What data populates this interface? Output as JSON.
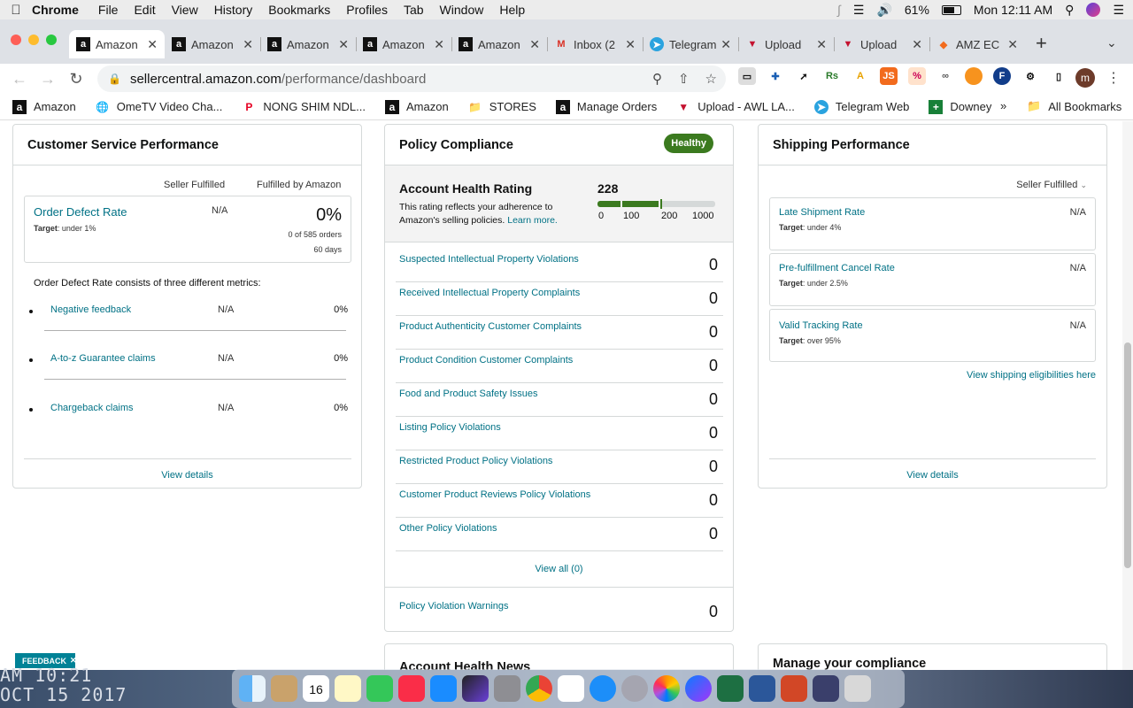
{
  "menubar": {
    "apple": "",
    "items": [
      "Chrome",
      "File",
      "Edit",
      "View",
      "History",
      "Bookmarks",
      "Profiles",
      "Tab",
      "Window",
      "Help"
    ],
    "battery": "61%",
    "clock": "Mon 12:11 AM"
  },
  "tabs": [
    {
      "title": "Amazon",
      "icon": "amazon-icon",
      "active": true
    },
    {
      "title": "Amazon",
      "icon": "amazon-icon"
    },
    {
      "title": "Amazon",
      "icon": "amazon-icon"
    },
    {
      "title": "Amazon",
      "icon": "amazon-icon"
    },
    {
      "title": "Amazon",
      "icon": "amazon-icon"
    },
    {
      "title": "Inbox (2",
      "icon": "gmail-icon"
    },
    {
      "title": "Telegram",
      "icon": "telegram-icon"
    },
    {
      "title": "Upload",
      "icon": "upload-icon"
    },
    {
      "title": "Upload",
      "icon": "upload-icon"
    },
    {
      "title": "AMZ EC",
      "icon": "amz-icon"
    }
  ],
  "toolbar": {
    "url_host": "sellercentral.amazon.com",
    "url_path": "/performance/dashboard",
    "profile_initial": "m"
  },
  "bookmarks": {
    "items": [
      {
        "label": "Amazon",
        "icon": "amazon-icon"
      },
      {
        "label": "OmeTV Video Cha...",
        "icon": "globe-icon"
      },
      {
        "label": "NONG SHIM NDL...",
        "icon": "gift-icon"
      },
      {
        "label": "Amazon",
        "icon": "pinterest-icon"
      },
      {
        "label": "STORES",
        "icon": "amazon-icon"
      },
      {
        "label": "Manage Orders",
        "icon": "folder-icon"
      },
      {
        "label": "Upload - AWL LA...",
        "icon": "amazon-icon"
      },
      {
        "label": "Telegram Web",
        "icon": "upload-icon"
      },
      {
        "label": "Downey",
        "icon": "telegram-icon"
      }
    ],
    "more": "»",
    "all": "All Bookmarks"
  },
  "customer_service": {
    "title": "Customer Service Performance",
    "col_seller": "Seller Fulfilled",
    "col_fba": "Fulfilled by Amazon",
    "odr_label": "Order Defect Rate",
    "odr_target_label": "Target",
    "odr_target": "under 1%",
    "odr_seller": "N/A",
    "odr_fba": "0%",
    "odr_orders": "0 of 585 orders",
    "odr_days": "60 days",
    "consists": "Order Defect Rate consists of three different metrics:",
    "metrics": [
      {
        "label": "Negative feedback",
        "seller": "N/A",
        "fba": "0%"
      },
      {
        "label": "A-to-z Guarantee claims",
        "seller": "N/A",
        "fba": "0%"
      },
      {
        "label": "Chargeback claims",
        "seller": "N/A",
        "fba": "0%"
      }
    ],
    "view_details": "View details"
  },
  "policy": {
    "title": "Policy Compliance",
    "badge": "Healthy",
    "ahr_title": "Account Health Rating",
    "ahr_desc": "This rating reflects your adherence to Amazon's selling policies.",
    "learn_more": "Learn more.",
    "ahr_value": "228",
    "ahr_value_num": 228,
    "ahr_ticks": [
      "0",
      "100",
      "200",
      "1000"
    ],
    "rows": [
      {
        "label": "Suspected Intellectual Property Violations",
        "value": "0"
      },
      {
        "label": "Received Intellectual Property Complaints",
        "value": "0"
      },
      {
        "label": "Product Authenticity Customer Complaints",
        "value": "0"
      },
      {
        "label": "Product Condition Customer Complaints",
        "value": "0"
      },
      {
        "label": "Food and Product Safety Issues",
        "value": "0"
      },
      {
        "label": "Listing Policy Violations",
        "value": "0"
      },
      {
        "label": "Restricted Product Policy Violations",
        "value": "0"
      },
      {
        "label": "Customer Product Reviews Policy Violations",
        "value": "0"
      },
      {
        "label": "Other Policy Violations",
        "value": "0"
      }
    ],
    "view_all": "View all (0)",
    "warnings_label": "Policy Violation Warnings",
    "warnings_value": "0",
    "next_card_title": "Account Health News"
  },
  "shipping": {
    "title": "Shipping Performance",
    "filter": "Seller Fulfilled",
    "target_label": "Target",
    "metrics": [
      {
        "label": "Late Shipment Rate",
        "target": "under 4%",
        "value": "N/A"
      },
      {
        "label": "Pre-fulfillment Cancel Rate",
        "target": "under 2.5%",
        "value": "N/A"
      },
      {
        "label": "Valid Tracking Rate",
        "target": "over 95%",
        "value": "N/A"
      }
    ],
    "eligibility_link": "View shipping eligibilities here",
    "view_details": "View details",
    "next_card_title": "Manage your compliance"
  },
  "feedback": "FEEDBACK",
  "desktop": {
    "clock_line1": "AM 10:21",
    "clock_line2": "OCT 15 2017"
  },
  "colors": {
    "link": "#007185",
    "healthy": "#3b7a1f",
    "feedback": "#008296"
  }
}
